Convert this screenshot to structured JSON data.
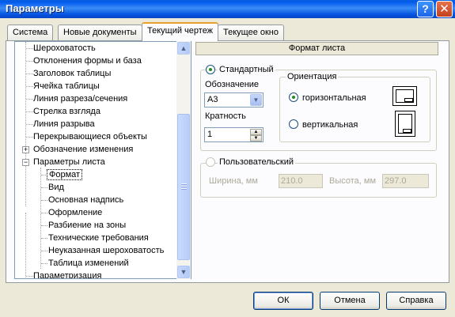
{
  "window": {
    "title": "Параметры"
  },
  "title_buttons": {
    "help": "?",
    "close": "✕"
  },
  "tabs": [
    {
      "label": "Система"
    },
    {
      "label": "Новые документы"
    },
    {
      "label": "Текущий чертеж"
    },
    {
      "label": "Текущее окно"
    }
  ],
  "tree": {
    "items": [
      {
        "label": "Шероховатость"
      },
      {
        "label": "Отклонения формы и база"
      },
      {
        "label": "Заголовок таблицы"
      },
      {
        "label": "Ячейка таблицы"
      },
      {
        "label": "Линия разреза/сечения"
      },
      {
        "label": "Стрелка взгляда"
      },
      {
        "label": "Линия разрыва"
      },
      {
        "label": "Перекрывающиеся объекты"
      },
      {
        "label": "Обозначение изменения",
        "expander": "+"
      },
      {
        "label": "Параметры листа",
        "expander": "−"
      },
      {
        "label": "Формат",
        "selected": true
      },
      {
        "label": "Вид"
      },
      {
        "label": "Основная надпись"
      },
      {
        "label": "Оформление"
      },
      {
        "label": "Разбиение на зоны"
      },
      {
        "label": "Технические требования"
      },
      {
        "label": "Неуказанная шероховатость"
      },
      {
        "label": "Таблица изменений"
      },
      {
        "label": "Параметризация"
      }
    ],
    "scroll_up": "▲",
    "scroll_down": "▼"
  },
  "panel": {
    "header": "Формат листа",
    "standard": {
      "label": "Стандартный",
      "selected": true,
      "designation_label": "Обозначение",
      "designation_value": "А3",
      "multiplicity_label": "Кратность",
      "multiplicity_value": "1",
      "dropdown_glyph": "▼",
      "spin_up": "▲",
      "spin_down": "▼"
    },
    "orientation": {
      "legend": "Ориентация",
      "landscape": "горизонтальная",
      "portrait": "вертикальная",
      "selected": "landscape"
    },
    "custom": {
      "label": "Пользовательский",
      "selected": false,
      "width_label": "Ширина, мм",
      "width_value": "210.0",
      "height_label": "Высота, мм",
      "height_value": "297.0"
    }
  },
  "buttons": {
    "ok": "ОК",
    "cancel": "Отмена",
    "help": "Справка"
  },
  "colors": {
    "titlebar": "#0058ee",
    "selected_radio_dot": "#1f8e1f",
    "active_tab_accent": "#e8a130"
  }
}
